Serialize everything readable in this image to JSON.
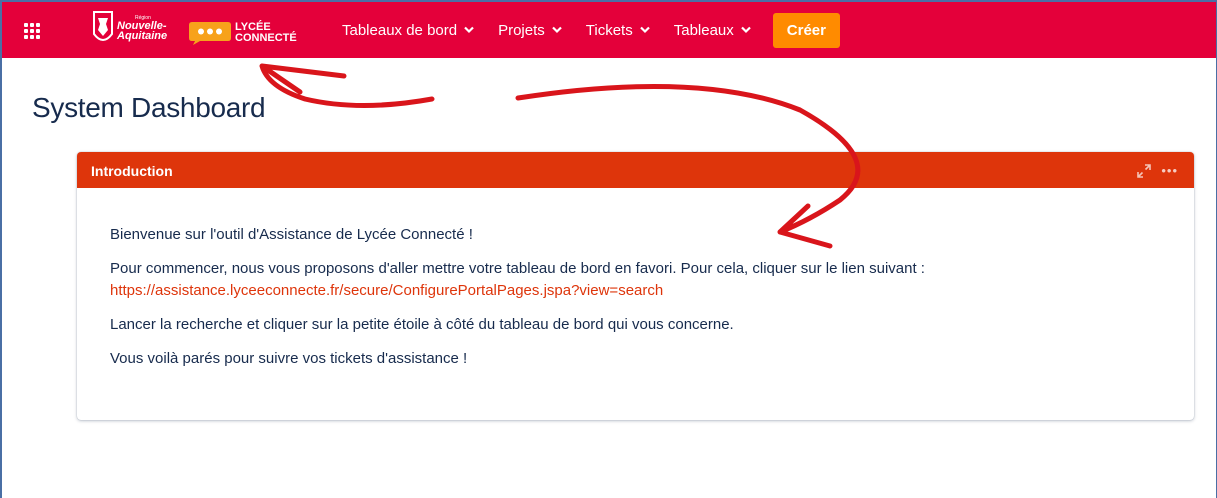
{
  "topbar": {
    "background": "#e4003a",
    "app_switcher_icon": "grid-icon",
    "logo": {
      "region_small": "Région",
      "region_line1": "Nouvelle-",
      "region_line2": "Aquitaine",
      "brand_line1": "LYCÉE",
      "brand_line2": "CONNECTÉ"
    },
    "nav": [
      {
        "label": "Tableaux de bord",
        "icon": "chevron-down-icon"
      },
      {
        "label": "Projets",
        "icon": "chevron-down-icon"
      },
      {
        "label": "Tickets",
        "icon": "chevron-down-icon"
      },
      {
        "label": "Tableaux",
        "icon": "chevron-down-icon"
      }
    ],
    "create_label": "Créer",
    "create_color": "#ff8b00"
  },
  "page": {
    "title": "System Dashboard"
  },
  "gadget": {
    "title": "Introduction",
    "header_color": "#de350b",
    "tools": [
      "expand-icon",
      "more-icon"
    ],
    "more_label": "•••",
    "paragraphs": {
      "welcome": "Bienvenue sur l'outil d'Assistance de Lycée Connecté !",
      "start": "Pour commencer, nous vous proposons d'aller mettre votre tableau de bord en favori. Pour cela, cliquer sur le lien suivant :",
      "link": "https://assistance.lyceeconnecte.fr/secure/ConfigurePortalPages.jspa?view=search",
      "search": "Lancer la recherche et cliquer sur la petite étoile à côté du tableau de bord qui vous concerne.",
      "ready": "Vous voilà parés pour suivre vos tickets d'assistance !"
    }
  },
  "annotation_color": "#d9151b"
}
